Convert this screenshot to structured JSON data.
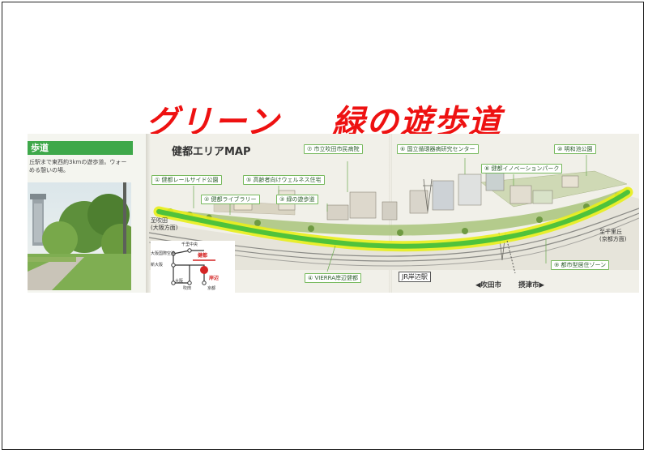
{
  "headline": {
    "left": "グリーン",
    "right": "緑の遊歩道"
  },
  "left_panel": {
    "heading": "歩道",
    "body_lines": [
      "丘駅まで東西約3kmの遊歩道。ウォー",
      "める憩いの場。"
    ]
  },
  "map": {
    "title": "健都エリアMAP",
    "points": [
      {
        "no": "①",
        "label": "健都レールサイド公園"
      },
      {
        "no": "②",
        "label": "健都ライブラリー"
      },
      {
        "no": "③",
        "label": "緑の遊歩道"
      },
      {
        "no": "④",
        "label": "VIERRA岸辺健都"
      },
      {
        "no": "⑤",
        "label": "高齢者向けウェルネス住宅"
      },
      {
        "no": "⑥",
        "label": "国立循環器病研究センター"
      },
      {
        "no": "⑦",
        "label": "市立吹田市民病院"
      },
      {
        "no": "⑧",
        "label": "健都イノベーションパーク"
      },
      {
        "no": "⑨",
        "label": "都市型居住ゾーン"
      },
      {
        "no": "⑩",
        "label": "明和池公園"
      }
    ],
    "direction_left": [
      "至吹田",
      "(大阪方面)"
    ],
    "direction_right": [
      "至千里丘",
      "(京都方面)"
    ],
    "station": "JR岸辺駅",
    "city_left": "◀吹田市",
    "city_right": "摂津市▶",
    "route_diagram": {
      "top": "千里中央",
      "row1": "大阪国際空港",
      "row2": "新大阪",
      "row3": "大阪",
      "mid1": "吹田",
      "mid2": "京都",
      "kento": "健都",
      "kishibe": "岸辺"
    }
  },
  "colors": {
    "headline": "#ee1111",
    "accent_green": "#3ea84a",
    "walkway_glow": "#e8ee1a",
    "walkway_core": "#4fc23b",
    "route_red": "#d42424"
  },
  "icons": [
    "tree-icon",
    "building-icon",
    "railway-icon"
  ]
}
